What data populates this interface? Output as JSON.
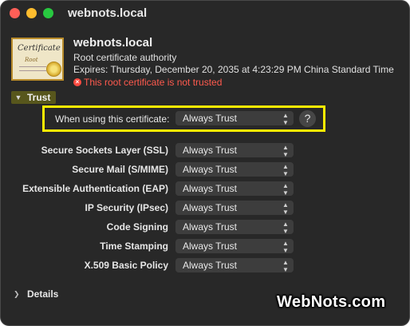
{
  "window": {
    "title": "webnots.local"
  },
  "certificate": {
    "icon_title": "Certificate",
    "icon_subtitle": "Root",
    "name": "webnots.local",
    "type": "Root certificate authority",
    "expires": "Expires: Thursday, December 20, 2035 at 4:23:29 PM China Standard Time",
    "warning": "This root certificate is not trusted",
    "warning_color": "#ff5a4e"
  },
  "trust": {
    "section_label": "Trust",
    "when_using_label": "When using this certificate:",
    "when_using_value": "Always Trust",
    "help_label": "?",
    "rows": [
      {
        "label": "Secure Sockets Layer (SSL)",
        "value": "Always Trust"
      },
      {
        "label": "Secure Mail (S/MIME)",
        "value": "Always Trust"
      },
      {
        "label": "Extensible Authentication (EAP)",
        "value": "Always Trust"
      },
      {
        "label": "IP Security (IPsec)",
        "value": "Always Trust"
      },
      {
        "label": "Code Signing",
        "value": "Always Trust"
      },
      {
        "label": "Time Stamping",
        "value": "Always Trust"
      },
      {
        "label": "X.509 Basic Policy",
        "value": "Always Trust"
      }
    ]
  },
  "details": {
    "label": "Details"
  },
  "watermark": "WebNots.com",
  "colors": {
    "highlight": "#ffee00",
    "window_bg": "#282828"
  }
}
